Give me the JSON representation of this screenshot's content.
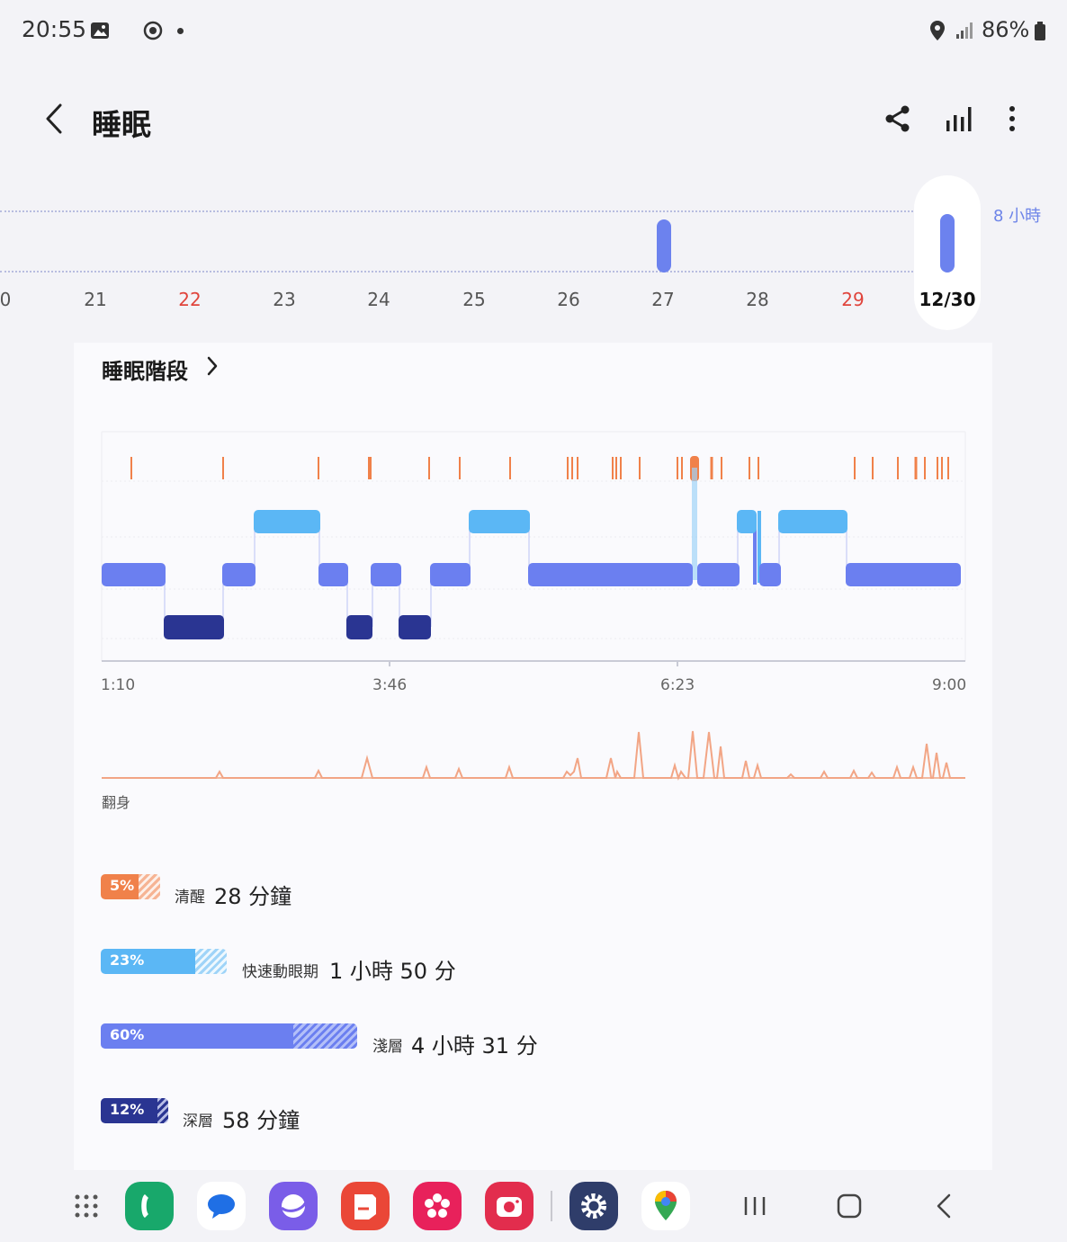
{
  "status_bar": {
    "time": "20:55",
    "battery": "86%",
    "icons": [
      "image-icon",
      "screen-record-icon",
      "location-icon",
      "signal-icon",
      "battery-icon"
    ]
  },
  "header": {
    "title": "睡眠",
    "icons": [
      "back-icon",
      "share-icon",
      "stats-icon",
      "more-icon"
    ]
  },
  "day_strip": {
    "goal_label": "8 小時",
    "days": [
      "0",
      "21",
      "22",
      "23",
      "24",
      "25",
      "26",
      "27",
      "28",
      "29"
    ],
    "weekend_days": [
      "22",
      "29"
    ],
    "selected_day": "12/30",
    "day_bars": [
      {
        "day": "27",
        "hours": 7.5
      },
      {
        "day": "12/30",
        "hours": 7.8
      }
    ]
  },
  "sleep_card": {
    "title": "睡眠階段",
    "time_axis": [
      "1:10",
      "3:46",
      "6:23",
      "9:00"
    ],
    "toss_label": "翻身"
  },
  "colors": {
    "awake": "#f0814a",
    "rem": "#5bb7f5",
    "light": "#6b7ff0",
    "deep": "#2a3592",
    "accent": "#6d84e8",
    "weekend": "#e0443c"
  },
  "legend": [
    {
      "pct": "5%",
      "name": "清醒",
      "value": "28 分鐘",
      "percent": 5
    },
    {
      "pct": "23%",
      "name": "快速動眼期",
      "value": "1 小時 50 分",
      "percent": 23
    },
    {
      "pct": "60%",
      "name": "淺層",
      "value": "4 小時 31 分",
      "percent": 60
    },
    {
      "pct": "12%",
      "name": "深層",
      "value": "58 分鐘",
      "percent": 12
    }
  ],
  "dock": {
    "apps": [
      "apps-grid-icon",
      "phone-icon",
      "messages-icon",
      "internet-icon",
      "notes-icon",
      "gallery-icon",
      "camera-icon",
      "settings-icon",
      "maps-icon"
    ],
    "nav": [
      "recents-icon",
      "home-icon",
      "back-nav-icon"
    ]
  }
}
